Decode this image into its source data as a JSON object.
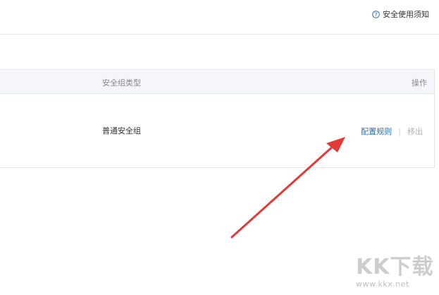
{
  "header": {
    "help_link": "安全使用须知",
    "help_icon": "question-circle-icon"
  },
  "table": {
    "columns": {
      "type_header": "安全组类型",
      "ops_header": "操作"
    },
    "rows": [
      {
        "type": "普通安全组",
        "actions": {
          "configure": "配置规则",
          "separator": "|",
          "remove": "移出"
        }
      }
    ]
  },
  "watermark": {
    "logo": "KK下载",
    "url": "www.kkx.net"
  },
  "colors": {
    "link": "#2c6fb0",
    "disabled": "#b3b3b3",
    "header_bg": "#f4f6f9",
    "arrow": "#e23a36"
  }
}
